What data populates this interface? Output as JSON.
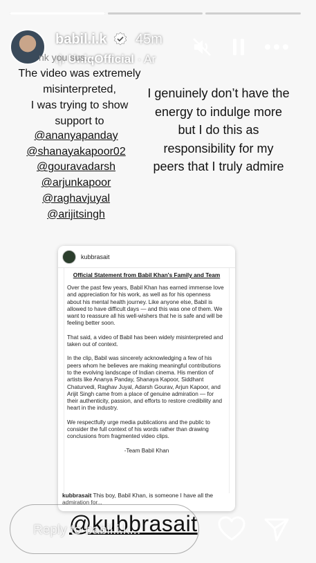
{
  "progress": [
    1.0,
    0.0,
    0.0
  ],
  "header": {
    "username": "babil.i.k",
    "time": "45m",
    "music_artist": "UniqOfficial",
    "music_sub": " · Ar",
    "icons": [
      "mute-icon",
      "pause-icon",
      "more-icon"
    ]
  },
  "left_text": {
    "faded_line": "nk you sus…",
    "lines": [
      "The  video was extremely",
      "misinterpreted,",
      "I was trying to show",
      "support to"
    ]
  },
  "mentions": [
    "@ananyapanday",
    "@shanayakapoor02",
    "@gouravadarsh",
    "@arjunkapoor",
    "@raghavjuyal",
    "@arijitsingh"
  ],
  "right_text": [
    "I genuinely don’t have the",
    "energy to indulge more",
    "but I do this as",
    "responsibility for my",
    "peers that I truly admire"
  ],
  "card": {
    "username": "kubbrasait",
    "title": "Official Statement from Babil Khan's Family and Team",
    "paragraphs": [
      "Over the past few years, Babil Khan has earned immense love and appreciation for his work, as well as for his openness about his mental health journey. Like anyone else, Babil is allowed to have difficult days — and this was one of them. We want to reassure all his well-wishers that he is safe and will be feeling better soon.",
      "That said, a video of Babil has been widely misinterpreted and taken out of context.",
      "In the clip, Babil was sincerely acknowledging a few of his peers whom he believes are making meaningful contributions to the evolving landscape of Indian cinema. His mention of artists like Ananya Panday, Shanaya Kapoor, Siddhant Chaturvedi, Raghav Juyal, Adarsh Gourav, Arjun Kapoor, and Arijit Singh came from a place of genuine admiration — for their authenticity, passion, and efforts to restore credibility and heart in the industry.",
      "We respectfully urge media publications and the public to consider the full context of his words rather than drawing conclusions from fragmented video clips."
    ],
    "signature": "-Team Babil Khan",
    "caption_user": "kubbrasait",
    "caption_text": " This boy, Babil Khan, is someone I have all the",
    "caption_line2": "admiration for..."
  },
  "sticker": "@kubbrasait",
  "reply": {
    "placeholder": "Reply to babil.i.k..."
  },
  "colors": {
    "background": "#f7f7f7",
    "text": "#111111",
    "overlay_text": "#ffffff"
  }
}
